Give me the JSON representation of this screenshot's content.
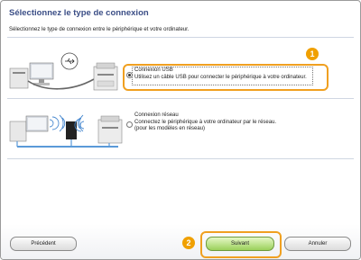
{
  "dialog": {
    "title": "Sélectionnez le type de connexion",
    "instruction": "Sélectionnez le type de connexion entre le périphérique et votre ordinateur."
  },
  "options": [
    {
      "title": "Connexion USB",
      "description": "Utilisez un câble USB pour connecter le périphérique à votre ordinateur.",
      "selected": true
    },
    {
      "title": "Connexion réseau",
      "description_line1": "Connectez le périphérique à votre ordinateur par le réseau.",
      "description_line2": "(pour les modèles en réseau)",
      "selected": false
    }
  ],
  "callouts": {
    "one": "1",
    "two": "2"
  },
  "buttons": {
    "back": "Précédent",
    "next": "Suivant",
    "cancel": "Annuler"
  },
  "colors": {
    "title": "#3b4e86",
    "callout": "#f0a000",
    "next_button": "#9ad05a"
  }
}
